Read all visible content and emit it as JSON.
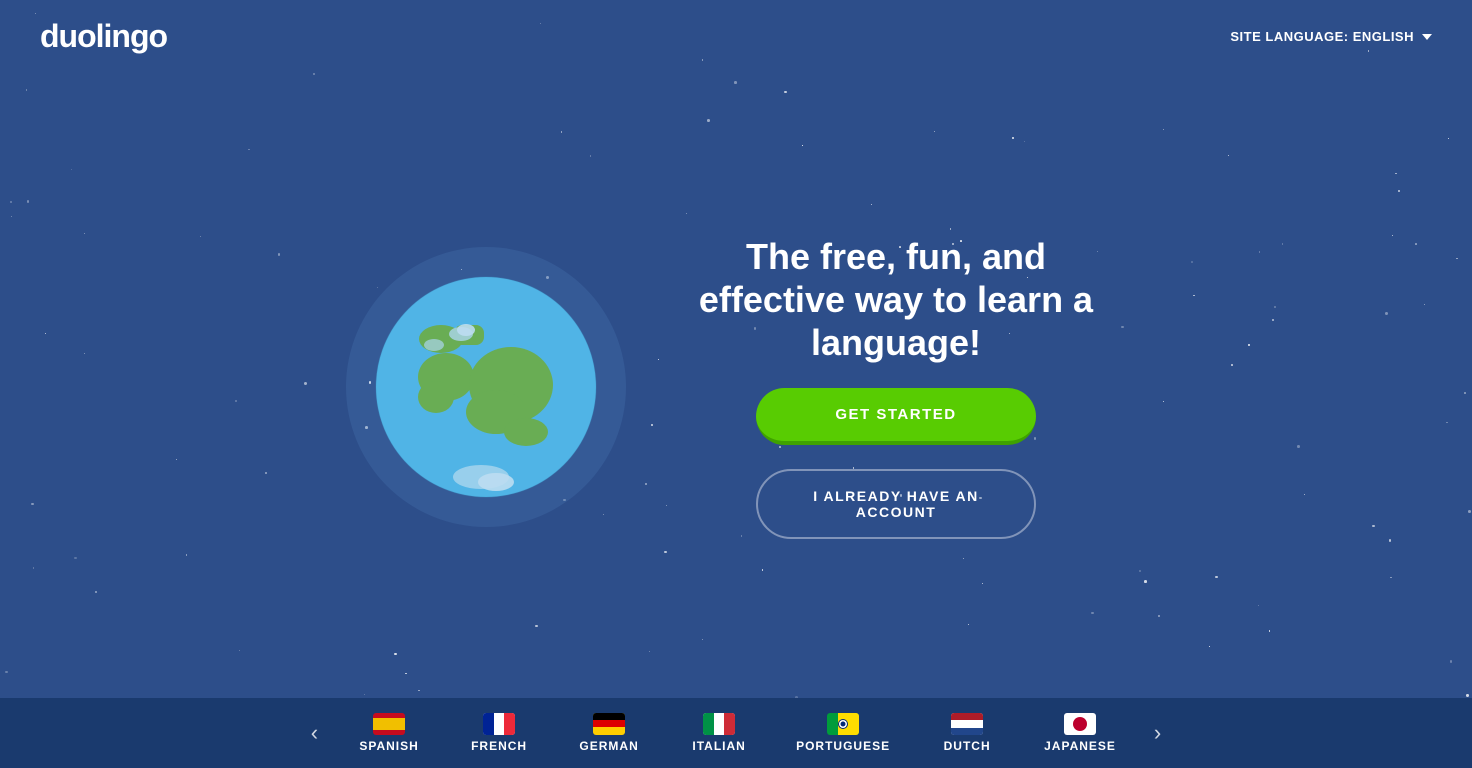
{
  "header": {
    "logo": "duolingo",
    "site_language_label": "SITE LANGUAGE: ENGLISH"
  },
  "main": {
    "tagline": "The free, fun, and effective way to learn a language!",
    "get_started_label": "GET STARTED",
    "have_account_label": "I ALREADY HAVE AN ACCOUNT"
  },
  "footer": {
    "prev_arrow": "‹",
    "next_arrow": "›",
    "languages": [
      {
        "name": "SPANISH",
        "flag": "spanish"
      },
      {
        "name": "FRENCH",
        "flag": "french"
      },
      {
        "name": "GERMAN",
        "flag": "german"
      },
      {
        "name": "ITALIAN",
        "flag": "italian"
      },
      {
        "name": "PORTUGUESE",
        "flag": "portuguese"
      },
      {
        "name": "DUTCH",
        "flag": "dutch"
      },
      {
        "name": "JAPANESE",
        "flag": "japanese"
      }
    ]
  },
  "colors": {
    "bg": "#2d4e8a",
    "footer_bg": "#1a3a6e",
    "green": "#58cc02",
    "green_dark": "#3fa200"
  }
}
